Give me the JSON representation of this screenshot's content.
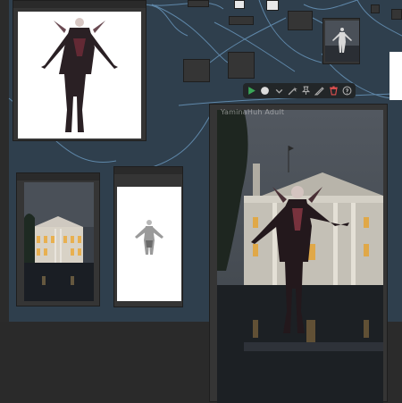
{
  "app": {
    "watermark_text": "YaminaHuh Adult"
  },
  "toolbar": {
    "buttons": [
      {
        "name": "play-icon",
        "color": "#3aa657"
      },
      {
        "name": "color-dot-icon",
        "color": "#dcdcdc"
      },
      {
        "name": "chevron-down-icon",
        "color": "#aaaaaa"
      },
      {
        "name": "wand-icon",
        "color": "#aaaaaa"
      },
      {
        "name": "pin-icon",
        "color": "#aaaaaa"
      },
      {
        "name": "pencil-icon",
        "color": "#aaaaaa"
      },
      {
        "name": "trash-icon",
        "color": "#e05050"
      },
      {
        "name": "help-icon",
        "color": "#aaaaaa"
      }
    ]
  },
  "colors": {
    "group": "#2f3f4d",
    "link": "#6fa0c8",
    "node": "#353535"
  }
}
